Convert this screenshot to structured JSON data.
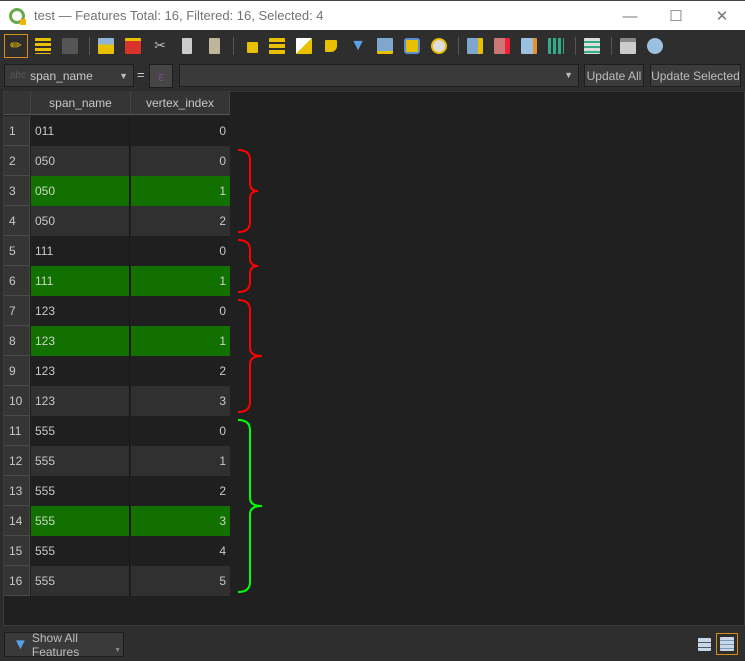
{
  "window": {
    "title": "test — Features Total: 16, Filtered: 16, Selected: 4",
    "controls": [
      "minimize",
      "maximize",
      "close"
    ]
  },
  "toolbar": {
    "buttons": [
      {
        "name": "toggle-editing",
        "icon": "pencil-icon",
        "active": true
      },
      {
        "name": "toggle-multi-edit",
        "icon": "multi-edit-icon"
      },
      {
        "name": "save-edits",
        "icon": "save-icon"
      },
      {
        "name": "add-feature",
        "icon": "add-feature-icon"
      },
      {
        "name": "delete-selected",
        "icon": "delete-icon"
      },
      {
        "name": "cut",
        "icon": "scissors-icon"
      },
      {
        "name": "copy",
        "icon": "copy-icon"
      },
      {
        "name": "paste",
        "icon": "paste-icon"
      },
      {
        "name": "select-by-expression",
        "icon": "select-expression-icon"
      },
      {
        "name": "select-all",
        "icon": "select-all-icon"
      },
      {
        "name": "invert-selection",
        "icon": "invert-selection-icon"
      },
      {
        "name": "deselect-all",
        "icon": "deselect-icon"
      },
      {
        "name": "filter-select-form",
        "icon": "filter-icon"
      },
      {
        "name": "move-selection-to-top",
        "icon": "move-top-icon"
      },
      {
        "name": "pan-to-selected",
        "icon": "pan-icon"
      },
      {
        "name": "zoom-to-selected",
        "icon": "zoom-icon"
      },
      {
        "name": "new-field",
        "icon": "new-field-icon"
      },
      {
        "name": "delete-field",
        "icon": "delete-field-icon"
      },
      {
        "name": "field-calculator",
        "icon": "field-calculator-icon"
      },
      {
        "name": "conditional-formatting",
        "icon": "conditional-format-icon"
      },
      {
        "name": "dock-table",
        "icon": "dock-icon"
      },
      {
        "name": "actions",
        "icon": "actions-icon"
      },
      {
        "name": "identify",
        "icon": "identify-icon"
      }
    ]
  },
  "filter_bar": {
    "field_type": "abc",
    "field": "span_name",
    "operator": "=",
    "expression_icon": "epsilon-icon",
    "value": "",
    "update_all_label": "Update All",
    "update_selected_label": "Update Selected"
  },
  "table": {
    "columns": [
      "span_name",
      "vertex_index"
    ],
    "rows": [
      {
        "n": "1",
        "span_name": "011",
        "vertex_index": "0",
        "selected": false
      },
      {
        "n": "2",
        "span_name": "050",
        "vertex_index": "0",
        "selected": false
      },
      {
        "n": "3",
        "span_name": "050",
        "vertex_index": "1",
        "selected": true
      },
      {
        "n": "4",
        "span_name": "050",
        "vertex_index": "2",
        "selected": false
      },
      {
        "n": "5",
        "span_name": "111",
        "vertex_index": "0",
        "selected": false
      },
      {
        "n": "6",
        "span_name": "111",
        "vertex_index": "1",
        "selected": true
      },
      {
        "n": "7",
        "span_name": "123",
        "vertex_index": "0",
        "selected": false
      },
      {
        "n": "8",
        "span_name": "123",
        "vertex_index": "1",
        "selected": true
      },
      {
        "n": "9",
        "span_name": "123",
        "vertex_index": "2",
        "selected": false
      },
      {
        "n": "10",
        "span_name": "123",
        "vertex_index": "3",
        "selected": false
      },
      {
        "n": "11",
        "span_name": "555",
        "vertex_index": "0",
        "selected": false
      },
      {
        "n": "12",
        "span_name": "555",
        "vertex_index": "1",
        "selected": false
      },
      {
        "n": "13",
        "span_name": "555",
        "vertex_index": "2",
        "selected": false
      },
      {
        "n": "14",
        "span_name": "555",
        "vertex_index": "3",
        "selected": true
      },
      {
        "n": "15",
        "span_name": "555",
        "vertex_index": "4",
        "selected": false
      },
      {
        "n": "16",
        "span_name": "555",
        "vertex_index": "5",
        "selected": false
      }
    ],
    "annotations": [
      {
        "rows": [
          "2",
          "4"
        ],
        "color": "#ff0000"
      },
      {
        "rows": [
          "5",
          "6"
        ],
        "color": "#ff0000"
      },
      {
        "rows": [
          "7",
          "10"
        ],
        "color": "#ff0000"
      },
      {
        "rows": [
          "11",
          "16"
        ],
        "color": "#00ff00"
      }
    ]
  },
  "bottom_bar": {
    "show_all_label": "Show All Features",
    "views": [
      "form-view",
      "table-view"
    ],
    "active_view": "table-view"
  },
  "colors": {
    "selected_row": "#117000",
    "active_border": "#d98a1a"
  }
}
